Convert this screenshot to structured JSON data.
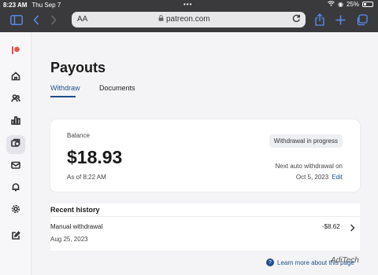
{
  "status_bar": {
    "time": "8:23 AM",
    "date": "Thu Sep 7",
    "dots": "•••",
    "battery": "25%"
  },
  "browser": {
    "text_size_label": "AA",
    "url": "patreon.com"
  },
  "sidebar": {
    "items": [
      {
        "name": "home",
        "active": false
      },
      {
        "name": "members",
        "active": false
      },
      {
        "name": "insights",
        "active": false
      },
      {
        "name": "payouts",
        "active": true
      },
      {
        "name": "messages",
        "active": false
      },
      {
        "name": "notifications",
        "active": false
      },
      {
        "name": "settings",
        "active": false
      },
      {
        "name": "create",
        "active": false
      }
    ]
  },
  "page": {
    "title": "Payouts"
  },
  "tabs": [
    {
      "label": "Withdraw",
      "active": true
    },
    {
      "label": "Documents",
      "active": false
    }
  ],
  "balance": {
    "label": "Balance",
    "amount": "$18.93",
    "as_of": "As of 8:22 AM",
    "status": "Withdrawal in progress",
    "next_label": "Next auto withdrawal on",
    "next_date": "Oct 5, 2023",
    "edit_label": "Edit"
  },
  "history": {
    "title": "Recent history",
    "items": [
      {
        "description": "Manual withdrawal",
        "date": "Aug 25, 2023",
        "amount": "-$8.62"
      }
    ]
  },
  "footer": {
    "learn_more": "Learn more about this page",
    "watermark": "AdiTech"
  },
  "colors": {
    "accent": "#1f4e8c",
    "brand": "#e8514b",
    "chrome": "#3a3a3c"
  }
}
